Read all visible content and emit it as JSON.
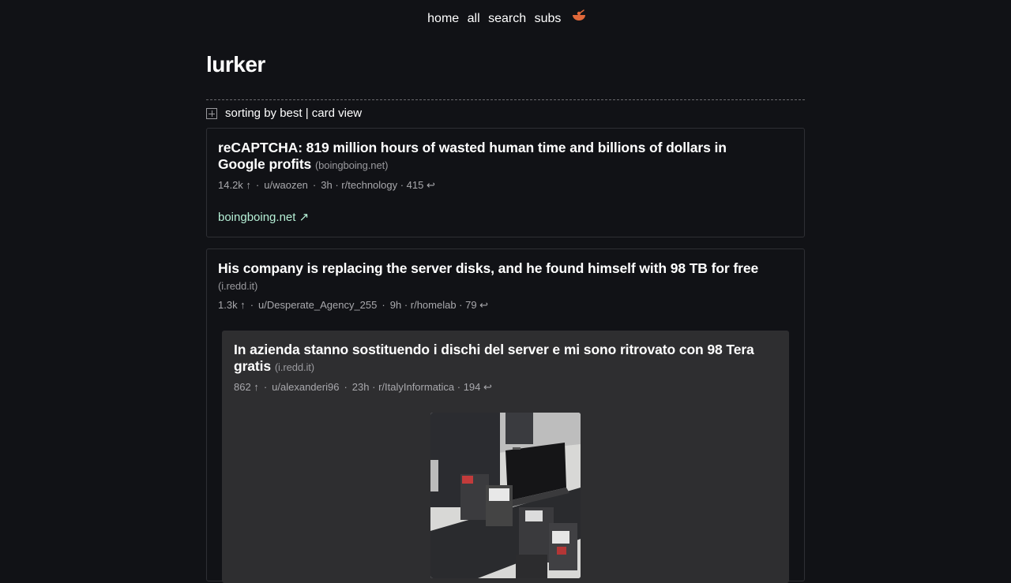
{
  "nav": {
    "home": "home",
    "all": "all",
    "search": "search",
    "subs": "subs"
  },
  "page": {
    "title": "lurker"
  },
  "sort": {
    "label": "sorting by best | card view"
  },
  "posts": [
    {
      "title": "reCAPTCHA: 819 million hours of wasted human time and billions of dollars in Google profits",
      "domain": "(boingboing.net)",
      "score": "14.2k ↑",
      "author": "u/waozen",
      "age": "3h",
      "sub_comments": "· r/technology · 415 ↩",
      "link": "boingboing.net ↗"
    },
    {
      "title": "His company is replacing the server disks, and he found himself with 98 TB for free",
      "domain": "(i.redd.it)",
      "score": "1.3k ↑",
      "author": "u/Desperate_Agency_255",
      "age": "9h",
      "sub_comments": "· r/homelab · 79 ↩",
      "crosspost": {
        "title": "In azienda stanno sostituendo i dischi del server e mi sono ritrovato con 98 Tera gratis",
        "domain": "(i.redd.it)",
        "score": "862 ↑",
        "author": "u/alexanderi96",
        "age": "23h",
        "sub_comments": "· r/ItalyInformatica · 194 ↩"
      }
    }
  ],
  "colors": {
    "background": "#111216",
    "link": "#b6f0d6",
    "accent_bowl": "#e0683a",
    "card_border": "#2e2f34",
    "crosspost_bg": "#2e2e30"
  },
  "icons": {
    "nav_logo": "bowl-icon",
    "sort_toggle": "plus-box-icon"
  }
}
